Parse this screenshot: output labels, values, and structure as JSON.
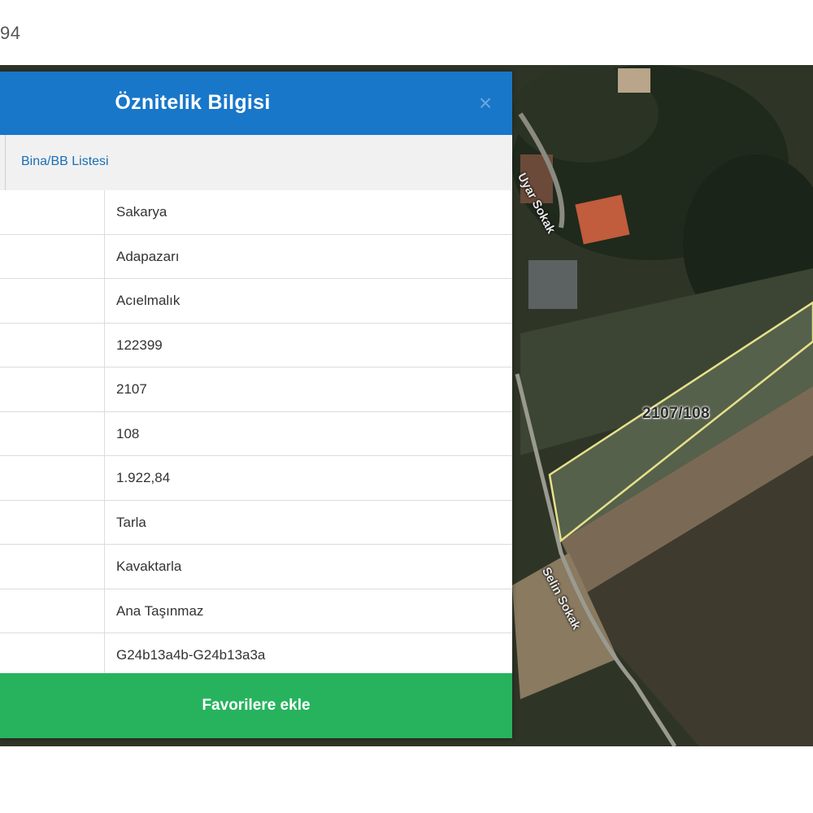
{
  "corner_text": "94",
  "map": {
    "streets": [
      "Uyar Sokak",
      "Selin Sokak"
    ],
    "parcel_label": "2107/108"
  },
  "panel": {
    "title": "Öznitelik Bilgisi",
    "close_glyph": "×",
    "tab_label": "Bina/BB Listesi",
    "rows": [
      {
        "value": "Sakarya"
      },
      {
        "value": "Adapazarı"
      },
      {
        "value": "Acıelmalık"
      },
      {
        "value": "122399"
      },
      {
        "value": "2107"
      },
      {
        "value": "108"
      },
      {
        "value": "1.922,84"
      },
      {
        "value": "Tarla"
      },
      {
        "value": "Kavaktarla"
      },
      {
        "value": "Ana Taşınmaz"
      },
      {
        "value": "G24b13a4b-G24b13a3a"
      }
    ],
    "favorite_button": "Favorilere ekle"
  },
  "colors": {
    "header": "#1877c9",
    "button": "#27b35e",
    "link": "#1a6fb5",
    "parcel_outline": "#e8e08a"
  }
}
